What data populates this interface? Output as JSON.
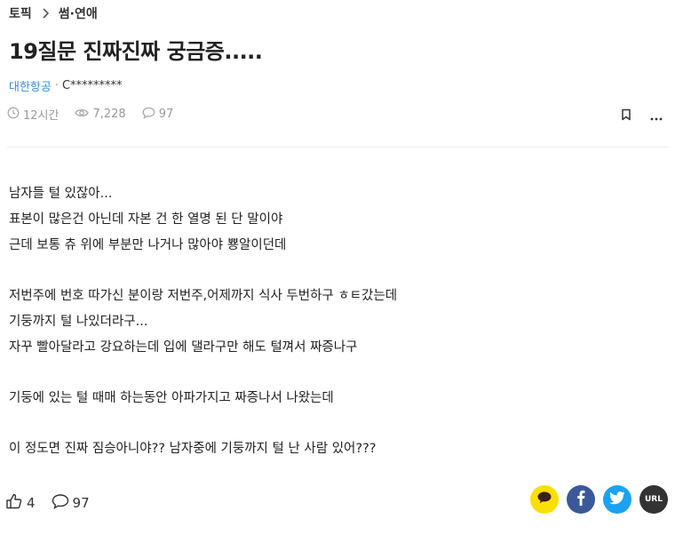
{
  "breadcrumb": {
    "root": "토픽",
    "category": "썸·연애"
  },
  "post": {
    "title": "19질문 진짜진짜 궁금증.....",
    "company": "대한항공",
    "separator": "·",
    "nickname": "C*********",
    "time": "12시간",
    "views": "7,228",
    "comments": "97"
  },
  "content": {
    "paragraphs": [
      [
        "남자들 털 있잖아...",
        "표본이 많은건 아닌데 자본 건 한 열명 된 단 말이야",
        "근데 보통 츄 위에 부분만 나거나 많아야 뿅알이던데"
      ],
      [
        "저번주에 번호 따가신 분이랑 저번주,어제까지 식사 두번하구 ㅎㅌ갔는데",
        "기둥까지 털 나있더라구...",
        "자꾸 빨아달라고 강요하는데 입에 댈라구만 해도 털껴서 짜증나구"
      ],
      [
        "기둥에 있는 털 때매 하는동안 아파가지고 짜증나서 나왔는데"
      ],
      [
        "이 정도면 진짜 짐승아니야?? 남자중에 기둥까지 털 난 사람 있어???"
      ]
    ]
  },
  "footer": {
    "likes": "4",
    "comments": "97",
    "share_url_label": "URL"
  },
  "colors": {
    "kakao": "#f9e000",
    "facebook": "#3b5998",
    "twitter": "#1da1f2",
    "url": "#333333",
    "company": "#3b8ed0"
  },
  "icons": [
    "chevron-right-icon",
    "clock-icon",
    "eye-icon",
    "comment-icon",
    "bookmark-icon",
    "more-icon",
    "like-icon",
    "kakao-icon",
    "facebook-icon",
    "twitter-icon"
  ]
}
